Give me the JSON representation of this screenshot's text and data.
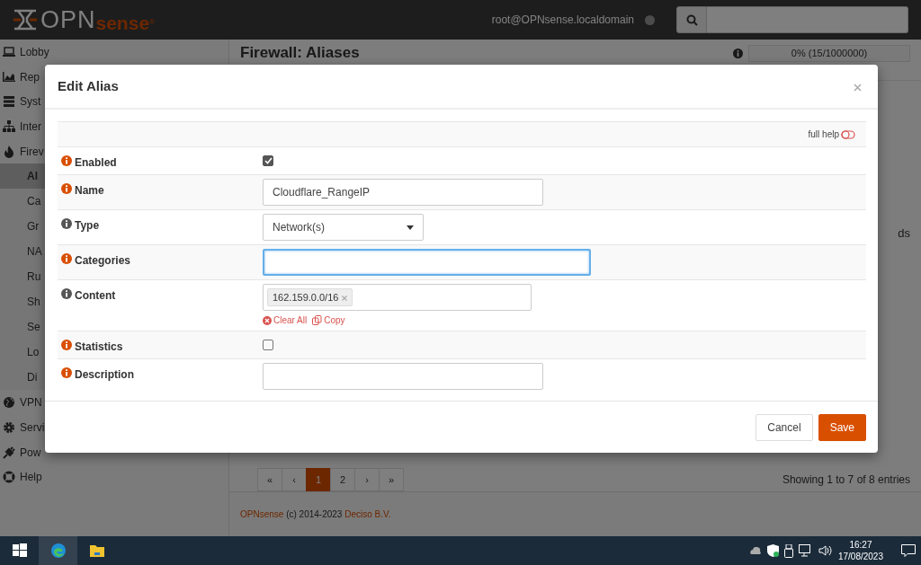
{
  "navbar": {
    "logo_main": "OPN",
    "logo_accent": "sense",
    "logo_mark": "®",
    "user": "root@OPNsense.localdomain"
  },
  "sidebar": {
    "items": [
      {
        "label": "Lobby",
        "selected": false
      },
      {
        "label": "Rep",
        "selected": false
      },
      {
        "label": "Syst",
        "selected": false
      },
      {
        "label": "Inter",
        "selected": false
      },
      {
        "label": "Firev",
        "selected": false,
        "children": [
          {
            "label": "Al",
            "selected": true
          },
          {
            "label": "Ca",
            "selected": false
          },
          {
            "label": "Gr",
            "selected": false
          },
          {
            "label": "NA",
            "selected": false
          },
          {
            "label": "Ru",
            "selected": false
          },
          {
            "label": "Sh",
            "selected": false
          },
          {
            "label": "Se",
            "selected": false
          },
          {
            "label": "Lo",
            "selected": false
          },
          {
            "label": "Di",
            "selected": false
          }
        ]
      },
      {
        "label": "VPN",
        "selected": false
      },
      {
        "label": "Servi",
        "selected": false
      },
      {
        "label": "Pow",
        "selected": false
      },
      {
        "label": "Help",
        "selected": false
      }
    ]
  },
  "page": {
    "title": "Firewall: Aliases",
    "usage": "0% (15/1000000)",
    "column_fragment": "ds",
    "pagination": [
      {
        "label": "«",
        "selected": false
      },
      {
        "label": "‹",
        "selected": false
      },
      {
        "label": "1",
        "selected": true
      },
      {
        "label": "2",
        "selected": false
      },
      {
        "label": "›",
        "selected": false
      },
      {
        "label": "»",
        "selected": false
      }
    ],
    "entries": "Showing 1 to 7 of 8 entries",
    "footer": {
      "brand": "OPNsense",
      "copyright": "(c) 2014-2023",
      "company": "Deciso B.V."
    }
  },
  "modal": {
    "title": "Edit Alias",
    "full_help": "full help",
    "fields": [
      {
        "kind": "checkbox",
        "label": "Enabled",
        "color": "#d94f00",
        "checked": true,
        "focused": false
      },
      {
        "kind": "text",
        "label": "Name",
        "color": "#d94f00",
        "value": "Cloudflare_RangeIP",
        "focused": false
      },
      {
        "kind": "select",
        "label": "Type",
        "color": "#555555",
        "value": "Network(s)",
        "focused": false
      },
      {
        "kind": "text",
        "label": "Categories",
        "color": "#d94f00",
        "focused": true
      },
      {
        "kind": "tokens",
        "label": "Content",
        "color": "#555555",
        "tokens": [
          "162.159.0.0/16"
        ],
        "actions": [
          "Clear All",
          "Copy"
        ],
        "focused": false
      },
      {
        "kind": "checkbox",
        "label": "Statistics",
        "color": "#d94f00",
        "checked": false,
        "focused": false
      },
      {
        "kind": "text",
        "label": "Description",
        "color": "#d94f00",
        "focused": false
      }
    ],
    "buttons": [
      {
        "label": "Cancel",
        "kind": "secondary"
      },
      {
        "label": "Save",
        "kind": "primary"
      }
    ]
  },
  "taskbar": {
    "apps": [
      {
        "selected": false
      },
      {
        "selected": true
      },
      {
        "selected": false
      }
    ],
    "time": "16:27",
    "date": "17/08/2023"
  }
}
